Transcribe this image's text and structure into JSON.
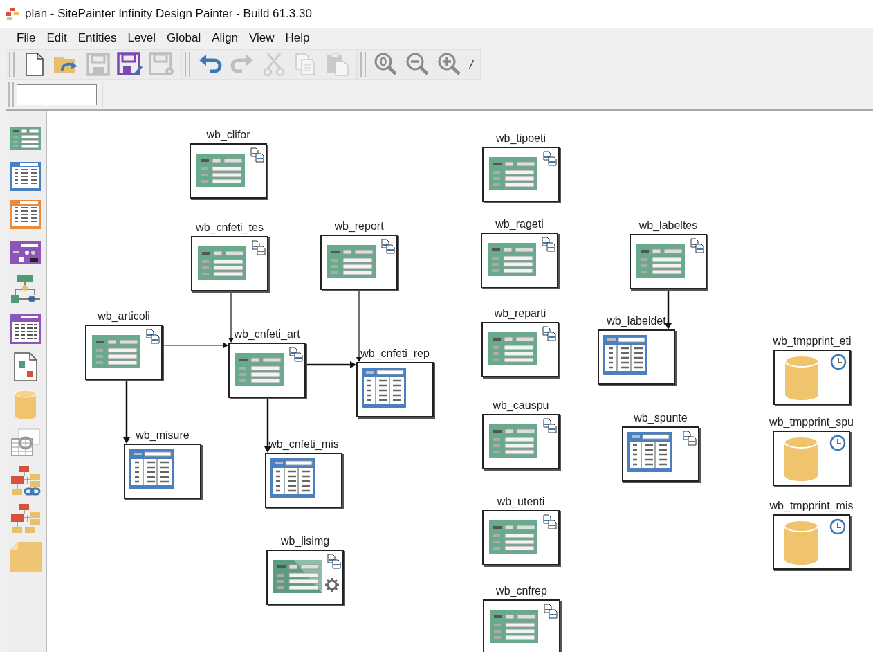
{
  "window": {
    "title": "plan - SitePainter Infinity Design Painter - Build 61.3.30"
  },
  "menu": [
    "File",
    "Edit",
    "Entities",
    "Level",
    "Global",
    "Align",
    "View",
    "Help"
  ],
  "toolbar": [
    [
      {
        "kind": "new",
        "disabled": false
      },
      {
        "kind": "open",
        "disabled": false
      },
      {
        "kind": "save",
        "disabled": true
      },
      {
        "kind": "save_as",
        "disabled": false
      },
      {
        "kind": "save_settings",
        "disabled": true
      }
    ],
    [
      {
        "kind": "undo",
        "disabled": false
      },
      {
        "kind": "redo",
        "disabled": true
      },
      {
        "kind": "cut",
        "disabled": true
      },
      {
        "kind": "copy",
        "disabled": true
      },
      {
        "kind": "paste",
        "disabled": true
      }
    ],
    [
      {
        "kind": "zoom_reset",
        "disabled": false
      },
      {
        "kind": "zoom_out",
        "disabled": false
      },
      {
        "kind": "zoom_in",
        "disabled": false
      },
      {
        "kind": "text",
        "label": "/",
        "disabled": false
      }
    ]
  ],
  "palette": [
    {
      "kind": "form"
    },
    {
      "kind": "table"
    },
    {
      "kind": "master_detail"
    },
    {
      "kind": "dialog"
    },
    {
      "kind": "process"
    },
    {
      "kind": "report"
    },
    {
      "kind": "document"
    },
    {
      "kind": "database"
    },
    {
      "kind": "query"
    },
    {
      "kind": "diagram_link"
    },
    {
      "kind": "diagram"
    },
    {
      "kind": "note"
    }
  ],
  "nodes": [
    {
      "label": "wb_clifor",
      "kind": "form",
      "linked": true
    },
    {
      "label": "wb_cnfeti_tes",
      "kind": "form",
      "linked": true
    },
    {
      "label": "wb_report",
      "kind": "form",
      "linked": true
    },
    {
      "label": "wb_articoli",
      "kind": "form",
      "linked": true
    },
    {
      "label": "wb_cnfeti_art",
      "kind": "form",
      "linked": true
    },
    {
      "label": "wb_cnfeti_rep",
      "kind": "table",
      "linked": false
    },
    {
      "label": "wb_misure",
      "kind": "table",
      "linked": false
    },
    {
      "label": "wb_cnfeti_mis",
      "kind": "table",
      "linked": false
    },
    {
      "label": "wb_lisimg",
      "kind": "generator",
      "linked": true
    },
    {
      "label": "wb_tipoeti",
      "kind": "form",
      "linked": true
    },
    {
      "label": "wb_rageti",
      "kind": "form",
      "linked": true
    },
    {
      "label": "wb_reparti",
      "kind": "form",
      "linked": true
    },
    {
      "label": "wb_causpu",
      "kind": "form",
      "linked": true
    },
    {
      "label": "wb_utenti",
      "kind": "form",
      "linked": true
    },
    {
      "label": "wb_cnfrep",
      "kind": "form",
      "linked": true
    },
    {
      "label": "wb_labeltes",
      "kind": "form",
      "linked": true
    },
    {
      "label": "wb_labeldet",
      "kind": "table",
      "linked": false
    },
    {
      "label": "wb_spunte",
      "kind": "table",
      "linked": true
    },
    {
      "label": "wb_tmpprint_eti",
      "kind": "database",
      "linked": false
    },
    {
      "label": "wb_tmpprint_spu",
      "kind": "database",
      "linked": false
    },
    {
      "label": "wb_tmpprint_mis",
      "kind": "database",
      "linked": false
    }
  ],
  "edges": [
    {
      "bold": false
    },
    {
      "bold": false
    },
    {
      "bold": false
    },
    {
      "bold": true
    },
    {
      "bold": true
    },
    {
      "bold": true
    },
    {
      "bold": true
    }
  ]
}
